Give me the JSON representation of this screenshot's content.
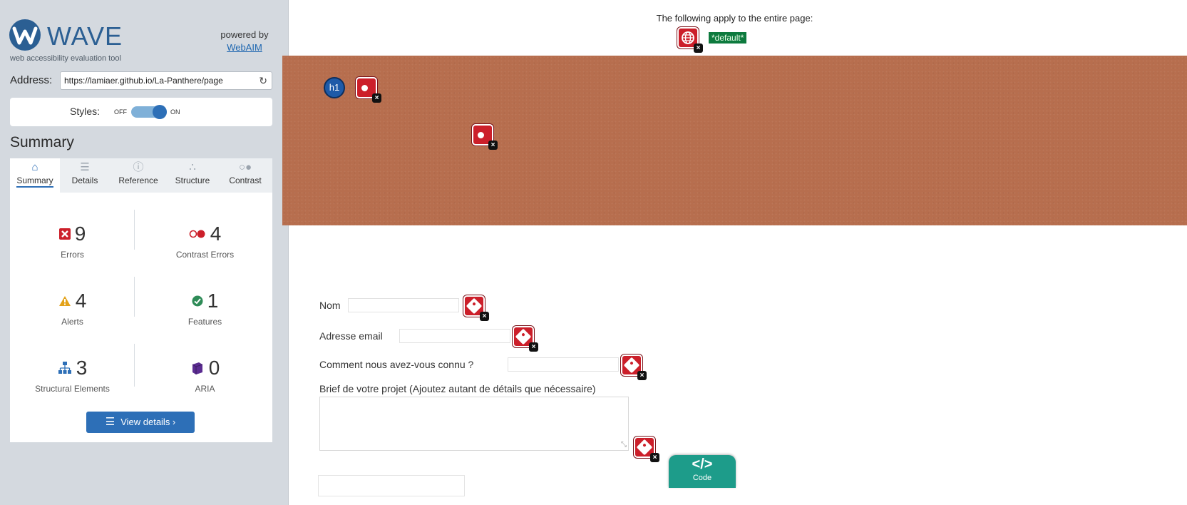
{
  "brand": {
    "name": "WAVE",
    "tagline": "web accessibility evaluation tool",
    "powered_by": "powered by",
    "powered_link": "WebAIM"
  },
  "address": {
    "label": "Address:",
    "value": "https://lamiaer.github.io/La-Panthere/page"
  },
  "styles": {
    "label": "Styles:",
    "off": "OFF",
    "on": "ON",
    "state": "on"
  },
  "summary_heading": "Summary",
  "tabs": [
    {
      "label": "Summary",
      "icon": "home-icon",
      "active": true
    },
    {
      "label": "Details",
      "icon": "list-icon",
      "active": false
    },
    {
      "label": "Reference",
      "icon": "info-icon",
      "active": false
    },
    {
      "label": "Structure",
      "icon": "structure-icon",
      "active": false
    },
    {
      "label": "Contrast",
      "icon": "contrast-icon",
      "active": false
    }
  ],
  "stats": {
    "errors": {
      "count": "9",
      "label": "Errors",
      "color": "#cc1f2a"
    },
    "contrast_errors": {
      "count": "4",
      "label": "Contrast Errors",
      "color": "#cc1f2a"
    },
    "alerts": {
      "count": "4",
      "label": "Alerts",
      "color": "#e3a21a"
    },
    "features": {
      "count": "1",
      "label": "Features",
      "color": "#2e8b57"
    },
    "structural": {
      "count": "3",
      "label": "Structural Elements",
      "color": "#2d6fb7"
    },
    "aria": {
      "count": "0",
      "label": "ARIA",
      "color": "#5b2c91"
    }
  },
  "view_details_label": "View details ›",
  "main": {
    "top_note": "The following apply to the entire page:",
    "default_badge": "*default*",
    "h1_badge": "h1",
    "form": {
      "name_label": "Nom",
      "email_label": "Adresse email",
      "source_label": "Comment nous avez-vous connu ?",
      "brief_label": "Brief de votre projet (Ajoutez autant de détails que nécessaire)"
    },
    "code_label": "Code",
    "code_icon": "</>"
  },
  "colors": {
    "accent": "#2d6fb7",
    "error": "#cc1f2a",
    "banner": "#b76e4e",
    "sidebar_bg": "#d4d9df",
    "code_button": "#1d9c8a"
  }
}
